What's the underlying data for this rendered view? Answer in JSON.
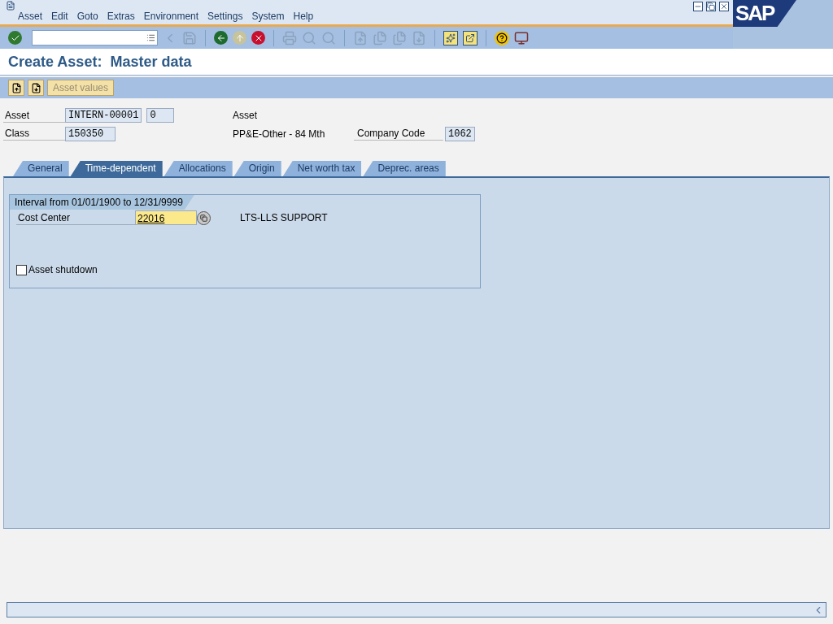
{
  "menu": [
    "Asset",
    "Edit",
    "Goto",
    "Extras",
    "Environment",
    "Settings",
    "System",
    "Help"
  ],
  "logo": "SAP",
  "title": "Create Asset:  Master data",
  "app_toolbar": {
    "button": "Asset values"
  },
  "header": {
    "asset_label": "Asset",
    "asset_number": "INTERN-00001",
    "sub_number": "0",
    "asset_description": "Asset",
    "class_label": "Class",
    "class_value": "150350",
    "class_description": "PP&E-Other - 84 Mth",
    "company_code_label": "Company Code",
    "company_code": "1062"
  },
  "tabs": [
    {
      "label": "General",
      "selected": false
    },
    {
      "label": "Time-dependent",
      "selected": true
    },
    {
      "label": "Allocations",
      "selected": false
    },
    {
      "label": "Origin",
      "selected": false
    },
    {
      "label": "Net worth tax",
      "selected": false
    },
    {
      "label": "Deprec. areas",
      "selected": false
    }
  ],
  "interval": {
    "title": "Interval from 01/01/1900 to 12/31/9999",
    "cost_center_label": "Cost Center",
    "cost_center": "22016",
    "cost_center_description": "LTS-LLS SUPPORT",
    "shutdown": {
      "label": "Asset shutdown",
      "checked": false
    }
  }
}
